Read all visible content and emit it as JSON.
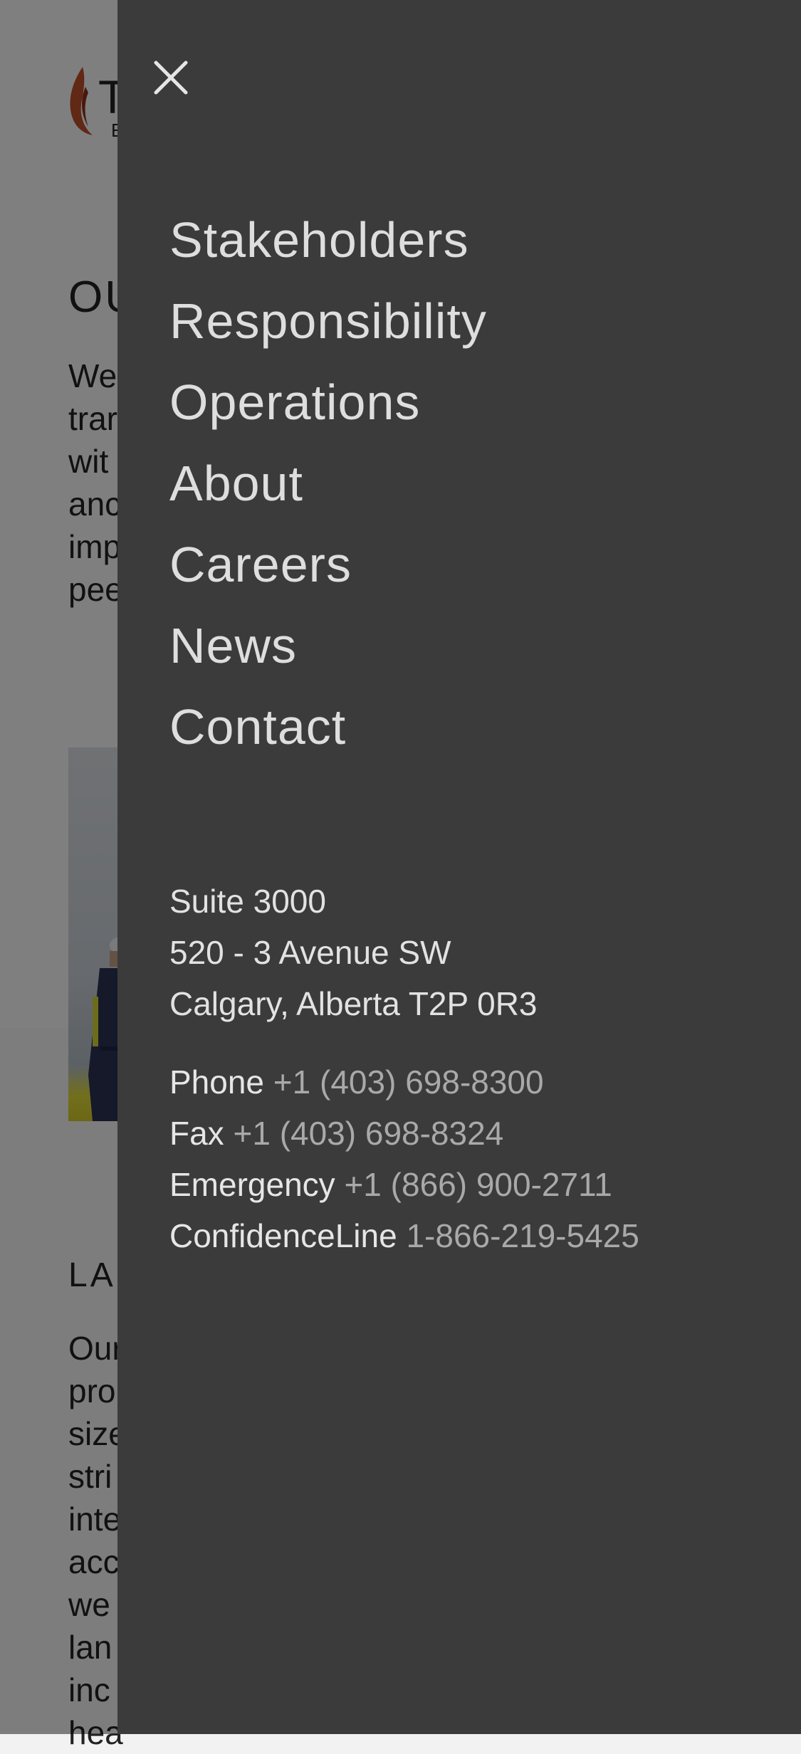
{
  "background": {
    "logo": {
      "text": "T",
      "subtext": "E"
    },
    "section1": {
      "heading": "OU",
      "lines": [
        "We",
        "trar",
        "wit",
        "anc",
        "imp",
        "pee"
      ]
    },
    "section2": {
      "heading": "LA",
      "lines": [
        "Our",
        "pro",
        "size",
        "stri",
        "inte",
        "acc",
        "we",
        "lan",
        "inc",
        "hea"
      ]
    }
  },
  "menu": {
    "close_icon": "close-icon",
    "items": [
      {
        "label": "Stakeholders"
      },
      {
        "label": "Responsibility"
      },
      {
        "label": "Operations"
      },
      {
        "label": "About"
      },
      {
        "label": "Careers"
      },
      {
        "label": "News"
      },
      {
        "label": "Contact"
      }
    ],
    "address": {
      "line1": "Suite 3000",
      "line2": "520 - 3 Avenue SW",
      "line3": "Calgary, Alberta T2P 0R3"
    },
    "contacts": [
      {
        "label": "Phone",
        "value": "+1 (403) 698-8300"
      },
      {
        "label": "Fax",
        "value": "+1 (403) 698-8324"
      },
      {
        "label": "Emergency",
        "value": "+1 (866) 900-2711"
      },
      {
        "label": "ConfidenceLine",
        "value": "1-866-219-5425"
      }
    ]
  },
  "colors": {
    "panel": "#3b3b3c",
    "menu_text": "#dedede",
    "contact_value": "#a9a9a9",
    "overlay": "rgba(0,0,0,0.5)",
    "flame": "#c0502a"
  }
}
